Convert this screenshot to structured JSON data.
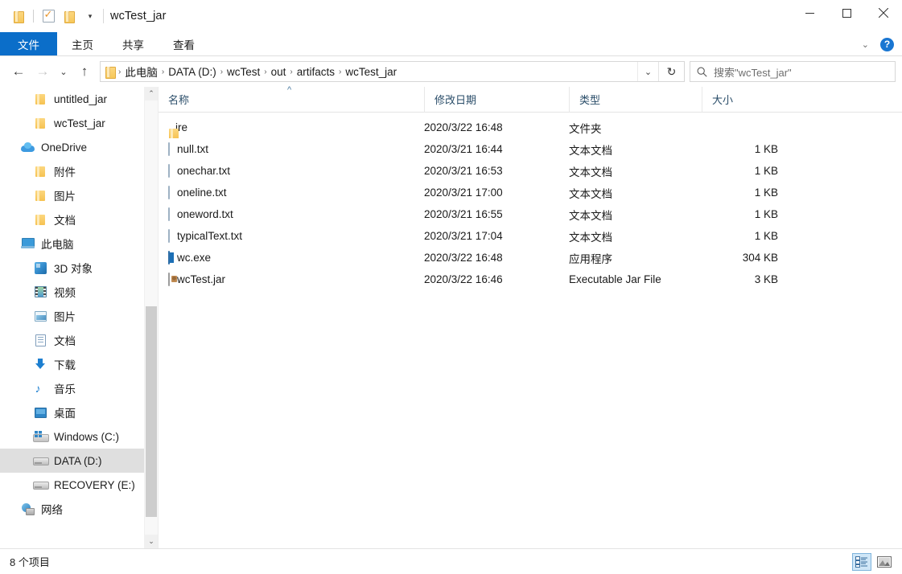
{
  "window": {
    "title": "wcTest_jar",
    "quick_access": [
      {
        "name": "folder-icon",
        "label": ""
      },
      {
        "name": "properties-icon",
        "label": ""
      },
      {
        "name": "new-folder-icon",
        "label": ""
      },
      {
        "name": "customize-chevron",
        "label": "▾"
      }
    ],
    "controls": {
      "minimize": "minimize",
      "maximize": "maximize",
      "close": "close"
    }
  },
  "ribbon": {
    "tabs": [
      {
        "label": "文件",
        "active": true
      },
      {
        "label": "主页",
        "active": false
      },
      {
        "label": "共享",
        "active": false
      },
      {
        "label": "查看",
        "active": false
      }
    ],
    "expand_label": "⌄",
    "help_label": "?"
  },
  "address": {
    "back_label": "←",
    "forward_label": "→",
    "recent_label": "⌄",
    "up_label": "↑",
    "crumbs": [
      "此电脑",
      "DATA (D:)",
      "wcTest",
      "out",
      "artifacts",
      "wcTest_jar"
    ],
    "separator": "›",
    "dropdown_label": "⌄",
    "refresh_label": "↻"
  },
  "search": {
    "placeholder": "搜索\"wcTest_jar\"",
    "icon": "search-icon"
  },
  "sidebar": {
    "items": [
      {
        "label": "untitled_jar",
        "icon": "folder-icon",
        "level": 2,
        "selected": false
      },
      {
        "label": "wcTest_jar",
        "icon": "folder-icon",
        "level": 2,
        "selected": false
      },
      {
        "label": "OneDrive",
        "icon": "onedrive-icon",
        "level": 1,
        "selected": false
      },
      {
        "label": "附件",
        "icon": "folder-icon",
        "level": 2,
        "selected": false
      },
      {
        "label": "图片",
        "icon": "folder-icon",
        "level": 2,
        "selected": false
      },
      {
        "label": "文档",
        "icon": "folder-icon",
        "level": 2,
        "selected": false
      },
      {
        "label": "此电脑",
        "icon": "this-pc-icon",
        "level": 1,
        "selected": false
      },
      {
        "label": "3D 对象",
        "icon": "3d-objects-icon",
        "level": 2,
        "selected": false
      },
      {
        "label": "视频",
        "icon": "videos-icon",
        "level": 2,
        "selected": false
      },
      {
        "label": "图片",
        "icon": "pictures-icon",
        "level": 2,
        "selected": false
      },
      {
        "label": "文档",
        "icon": "documents-icon",
        "level": 2,
        "selected": false
      },
      {
        "label": "下载",
        "icon": "downloads-icon",
        "level": 2,
        "selected": false
      },
      {
        "label": "音乐",
        "icon": "music-icon",
        "level": 2,
        "selected": false
      },
      {
        "label": "桌面",
        "icon": "desktop-icon",
        "level": 2,
        "selected": false
      },
      {
        "label": "Windows (C:)",
        "icon": "windows-drive-icon",
        "level": 2,
        "selected": false
      },
      {
        "label": "DATA (D:)",
        "icon": "drive-icon",
        "level": 2,
        "selected": true
      },
      {
        "label": "RECOVERY (E:)",
        "icon": "drive-icon",
        "level": 2,
        "selected": false
      },
      {
        "label": "网络",
        "icon": "network-icon",
        "level": 1,
        "selected": false
      }
    ]
  },
  "filelist": {
    "columns": [
      {
        "label": "名称",
        "key": "name"
      },
      {
        "label": "修改日期",
        "key": "date"
      },
      {
        "label": "类型",
        "key": "type"
      },
      {
        "label": "大小",
        "key": "size"
      }
    ],
    "sort_indicator": "^",
    "rows": [
      {
        "name": "jre",
        "date": "2020/3/22 16:48",
        "type": "文件夹",
        "size": "",
        "icon": "folder-icon"
      },
      {
        "name": "null.txt",
        "date": "2020/3/21 16:44",
        "type": "文本文档",
        "size": "1 KB",
        "icon": "text-file-icon"
      },
      {
        "name": "onechar.txt",
        "date": "2020/3/21 16:53",
        "type": "文本文档",
        "size": "1 KB",
        "icon": "text-file-icon"
      },
      {
        "name": "oneline.txt",
        "date": "2020/3/21 17:00",
        "type": "文本文档",
        "size": "1 KB",
        "icon": "text-file-icon"
      },
      {
        "name": "oneword.txt",
        "date": "2020/3/21 16:55",
        "type": "文本文档",
        "size": "1 KB",
        "icon": "text-file-icon"
      },
      {
        "name": "typicalText.txt",
        "date": "2020/3/21 17:04",
        "type": "文本文档",
        "size": "1 KB",
        "icon": "text-file-icon"
      },
      {
        "name": "wc.exe",
        "date": "2020/3/22 16:48",
        "type": "应用程序",
        "size": "304 KB",
        "icon": "application-icon"
      },
      {
        "name": "wcTest.jar",
        "date": "2020/3/22 16:46",
        "type": "Executable Jar File",
        "size": "3 KB",
        "icon": "jar-file-icon"
      }
    ]
  },
  "status": {
    "item_count": "8 个项目",
    "views": [
      {
        "name": "details-view",
        "active": true
      },
      {
        "name": "large-icons-view",
        "active": false
      }
    ]
  },
  "colors": {
    "accent": "#0b6ec9",
    "selection": "#dfdfdf",
    "header_text": "#2a4d69"
  }
}
